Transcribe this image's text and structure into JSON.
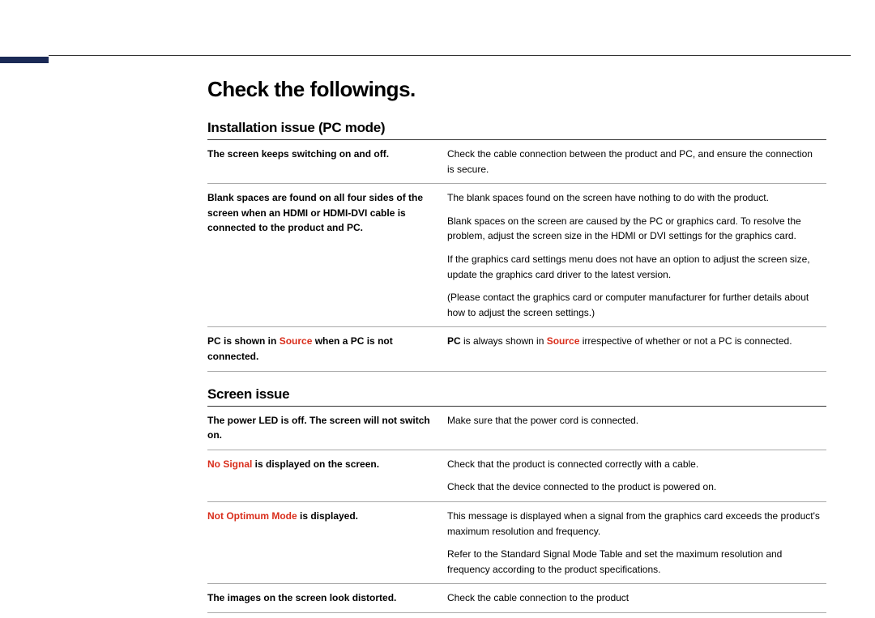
{
  "title": "Check the followings.",
  "sections": {
    "install": {
      "heading": "Installation issue (PC mode)",
      "rows": {
        "switching": {
          "issue": "The screen keeps switching on and off.",
          "answer": "Check the cable connection between the product and PC, and ensure the connection is secure."
        },
        "blank": {
          "issue": "Blank spaces are found on all four sides of the screen when an HDMI or HDMI-DVI cable is connected to the product and PC.",
          "p1": "The blank spaces found on the screen have nothing to do with the product.",
          "p2": "Blank spaces on the screen are caused by the PC or graphics card. To resolve the problem, adjust the screen size in the HDMI or DVI settings for the graphics card.",
          "p3": "If the graphics card settings menu does not have an option to adjust the screen size, update the graphics card driver to the latest version.",
          "p4": "(Please contact the graphics card or computer manufacturer for further details about how to adjust the screen settings.)"
        },
        "pcsource": {
          "issue_pre": "PC",
          "issue_mid": " is shown in ",
          "issue_src": "Source",
          "issue_post": " when a PC is not connected.",
          "ans_pre": "PC",
          "ans_mid": " is always shown in ",
          "ans_src": "Source",
          "ans_post": " irrespective of whether or not a PC is connected."
        }
      }
    },
    "screen": {
      "heading": "Screen issue",
      "rows": {
        "powerled": {
          "issue": "The power LED is off. The screen will not switch on.",
          "answer": "Make sure that the power cord is connected."
        },
        "nosignal": {
          "issue_red": "No Signal",
          "issue_rest": " is displayed on the screen.",
          "p1": "Check that the product is connected correctly with a cable.",
          "p2": "Check that the device connected to the product is powered on."
        },
        "notopt": {
          "issue_red": "Not Optimum Mode",
          "issue_rest": " is displayed.",
          "p1": "This message is displayed when a signal from the graphics card exceeds the product's maximum resolution and frequency.",
          "p2": "Refer to the Standard Signal Mode Table and set the maximum resolution and frequency according to the product specifications."
        },
        "distorted": {
          "issue": "The images on the screen look distorted.",
          "answer": "Check the cable connection to the product"
        }
      }
    }
  }
}
